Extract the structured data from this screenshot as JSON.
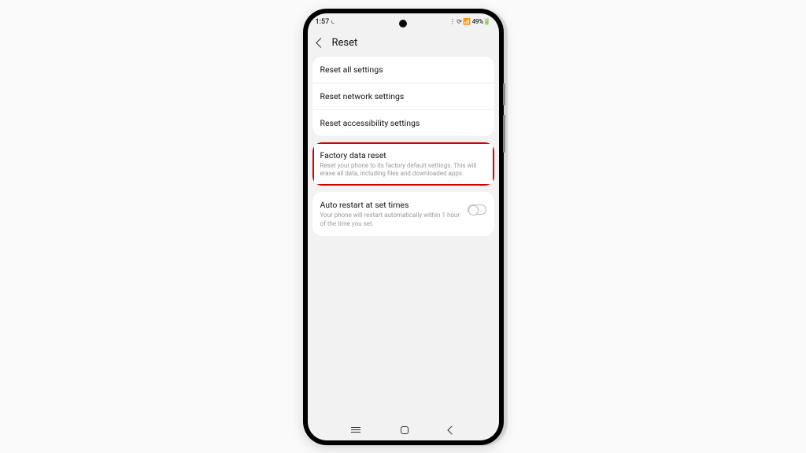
{
  "status": {
    "time": "1:57",
    "time_suffix": "⏾",
    "right": "⋮ ⟳ 📶 49%🔋"
  },
  "header": {
    "title": "Reset"
  },
  "group1": {
    "reset_all": "Reset all settings",
    "reset_network": "Reset network settings",
    "reset_access": "Reset accessibility settings"
  },
  "group2": {
    "factory_title": "Factory data reset",
    "factory_desc": "Reset your phone to its factory default settings. This will erase all data, including files and downloaded apps."
  },
  "group3": {
    "auto_title": "Auto restart at set times",
    "auto_desc": "Your phone will restart automatically within 1 hour of the time you set."
  }
}
